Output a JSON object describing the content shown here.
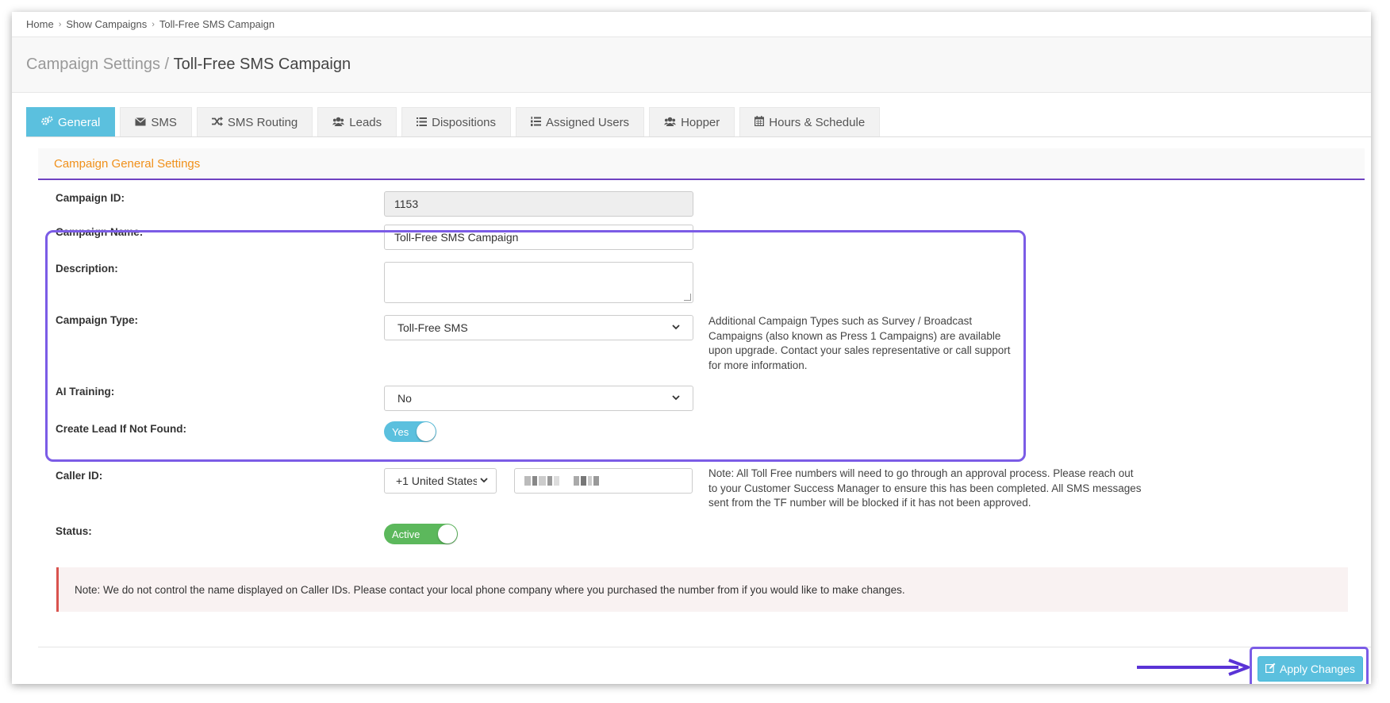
{
  "breadcrumb": [
    "Home",
    "Show Campaigns",
    "Toll-Free SMS Campaign"
  ],
  "header": {
    "section": "Campaign Settings",
    "separator": " / ",
    "title": "Toll-Free SMS Campaign"
  },
  "tabs": [
    {
      "label": "General",
      "icon": "gears-icon",
      "active": true
    },
    {
      "label": "SMS",
      "icon": "envelope-icon"
    },
    {
      "label": "SMS Routing",
      "icon": "random-icon"
    },
    {
      "label": "Leads",
      "icon": "users-icon"
    },
    {
      "label": "Dispositions",
      "icon": "list-icon"
    },
    {
      "label": "Assigned Users",
      "icon": "list-ol-icon"
    },
    {
      "label": "Hopper",
      "icon": "users-icon"
    },
    {
      "label": "Hours & Schedule",
      "icon": "calendar-icon"
    }
  ],
  "panel": {
    "title": "Campaign General Settings"
  },
  "form": {
    "campaign_id": {
      "label": "Campaign ID:",
      "value": "1153"
    },
    "campaign_name": {
      "label": "Campaign Name:",
      "value": "Toll-Free SMS Campaign"
    },
    "description": {
      "label": "Description:",
      "value": ""
    },
    "campaign_type": {
      "label": "Campaign Type:",
      "value": "Toll-Free SMS",
      "help": "Additional Campaign Types such as Survey / Broadcast Campaigns (also known as Press 1 Campaigns) are available upon upgrade. Contact your sales representative or call support for more information."
    },
    "ai_training": {
      "label": "AI Training:",
      "value": "No"
    },
    "create_lead": {
      "label": "Create Lead If Not Found:",
      "toggle": "Yes"
    },
    "caller_id": {
      "label": "Caller ID:",
      "country": "+1 United States",
      "help": "Note: All Toll Free numbers will need to go through an approval process. Please reach out to your Customer Success Manager to ensure this has been completed. All SMS messages sent from the TF number will be blocked if it has not been approved."
    },
    "status": {
      "label": "Status:",
      "toggle": "Active"
    }
  },
  "note": "Note: We do not control the name displayed on Caller IDs. Please contact your local phone company where you purchased the number from if you would like to make changes.",
  "apply_button": "Apply Changes",
  "colors": {
    "accent": "#5bc0de",
    "highlight": "#7b5ce6",
    "panel_title": "#f0901a",
    "success": "#5cb85c",
    "danger": "#d9534f"
  }
}
